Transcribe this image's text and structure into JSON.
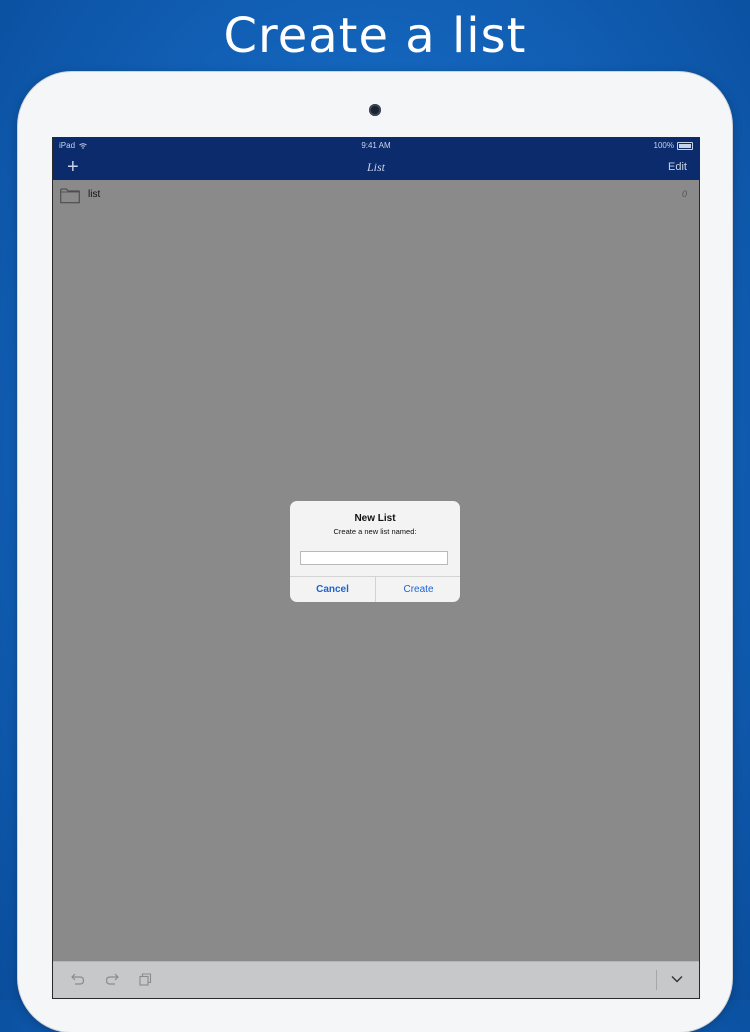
{
  "headline": "Create a list",
  "status_bar": {
    "carrier": "iPad",
    "time": "9:41 AM",
    "battery": "100%"
  },
  "nav_bar": {
    "title": "List",
    "add_label": "+",
    "edit_label": "Edit"
  },
  "lists": [
    {
      "name": "list",
      "count": "0",
      "icon": "folder-icon"
    }
  ],
  "dialog": {
    "title": "New List",
    "message": "Create a new list named:",
    "input_value": "",
    "cancel_label": "Cancel",
    "create_label": "Create"
  },
  "toolbar": {
    "icons": [
      "undo-icon",
      "redo-icon",
      "copy-icon",
      "chevron-down-icon"
    ]
  },
  "colors": {
    "background_blue": "#1466be",
    "nav_blue": "#0b2b6d",
    "overlay_gray": "#8a8a8b",
    "button_blue": "#1e63d0"
  }
}
